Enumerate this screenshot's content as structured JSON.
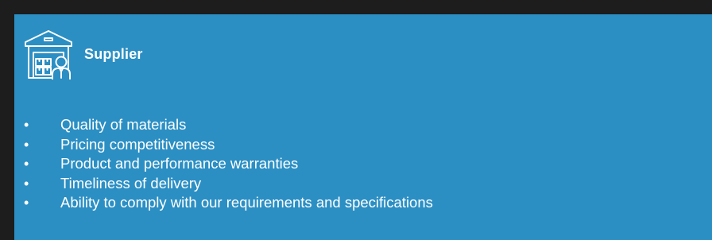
{
  "section": {
    "title": "Supplier",
    "icon": "supplier-warehouse-icon"
  },
  "items": [
    {
      "bullet": "•",
      "text": "Quality of materials"
    },
    {
      "bullet": "•",
      "text": "Pricing competitiveness"
    },
    {
      "bullet": "•",
      "text": "Product and performance warranties"
    },
    {
      "bullet": "•",
      "text": "Timeliness of delivery"
    },
    {
      "bullet": "•",
      "text": "Ability to comply with our requirements and specifications"
    }
  ],
  "colors": {
    "panel_background": "#2b8fc4",
    "page_background": "#1d1d1d",
    "text": "#ffffff"
  }
}
